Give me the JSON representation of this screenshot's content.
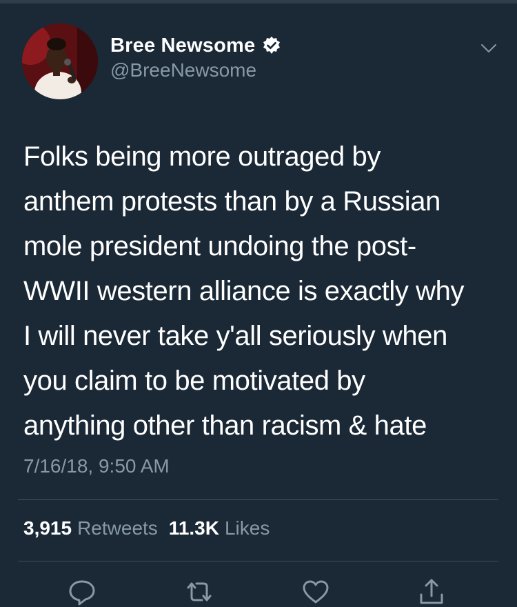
{
  "tweet": {
    "author": {
      "display_name": "Bree Newsome",
      "handle": "@BreeNewsome",
      "verified": true,
      "verified_icon": "verified-badge-icon"
    },
    "text_lines": [
      "Folks being more outraged by",
      "anthem protests than by a Russian",
      "mole president undoing the post-",
      "WWII western alliance is exactly why",
      "I will never take y'all seriously when",
      "you claim to be motivated by",
      "anything other than racism & hate"
    ],
    "timestamp": "7/16/18, 9:50 AM",
    "stats": {
      "retweets_count": "3,915",
      "retweets_label": "Retweets",
      "likes_count": "11.3K",
      "likes_label": "Likes"
    }
  },
  "actions": [
    {
      "name": "reply",
      "icon": "reply-icon"
    },
    {
      "name": "retweet",
      "icon": "retweet-icon"
    },
    {
      "name": "like",
      "icon": "like-icon"
    },
    {
      "name": "share",
      "icon": "share-icon"
    }
  ],
  "colors": {
    "background": "#1b2836",
    "text_primary": "#ffffff",
    "text_secondary": "#8899a6",
    "divider": "#3d4f61",
    "icon": "#8899a6"
  }
}
